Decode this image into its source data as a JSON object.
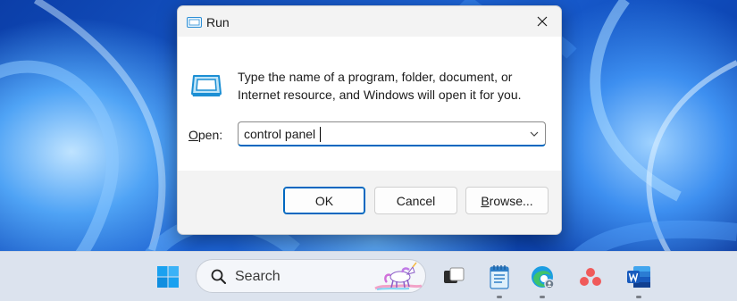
{
  "dialog": {
    "title": "Run",
    "description": "Type the name of a program, folder, document, or Internet resource, and Windows will open it for you.",
    "open_label_mnemonic": "O",
    "open_label_rest": "pen:",
    "open_value": "control panel",
    "buttons": {
      "ok": "OK",
      "cancel": "Cancel",
      "browse_mnemonic": "B",
      "browse_rest": "rowse..."
    },
    "icons": [
      "run-icon",
      "close-icon",
      "chevron-down-icon"
    ]
  },
  "taskbar": {
    "search_placeholder": "Search",
    "icons": [
      "windows-start-icon",
      "search-icon",
      "task-view-icon",
      "notepad-icon",
      "edge-icon",
      "app-red-dots-icon",
      "word-icon"
    ]
  },
  "colors": {
    "accent": "#0067c0",
    "wallpaper": "#1c63d6",
    "taskbar": "#dce3ee"
  }
}
